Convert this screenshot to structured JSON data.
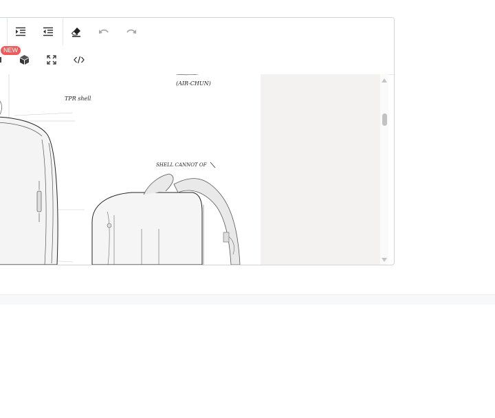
{
  "toolbar": {
    "row1": [
      {
        "name": "indent-icon"
      },
      {
        "name": "outdent-icon"
      },
      {
        "name": "eraser-icon"
      },
      {
        "name": "undo-icon"
      },
      {
        "name": "redo-icon"
      }
    ],
    "row2": [
      {
        "name": "cube-icon"
      },
      {
        "name": "fullscreen-icon"
      },
      {
        "name": "code-view-icon"
      }
    ],
    "new_badge": "NEW"
  },
  "sketch": {
    "annotations": [
      "TPR shell",
      "(AIR-CHUN)",
      "SHELL CANNOT OF"
    ]
  },
  "colors": {
    "badge": "#ef5b5b",
    "panel": "#f3f2f0",
    "border": "#d1d5db"
  }
}
